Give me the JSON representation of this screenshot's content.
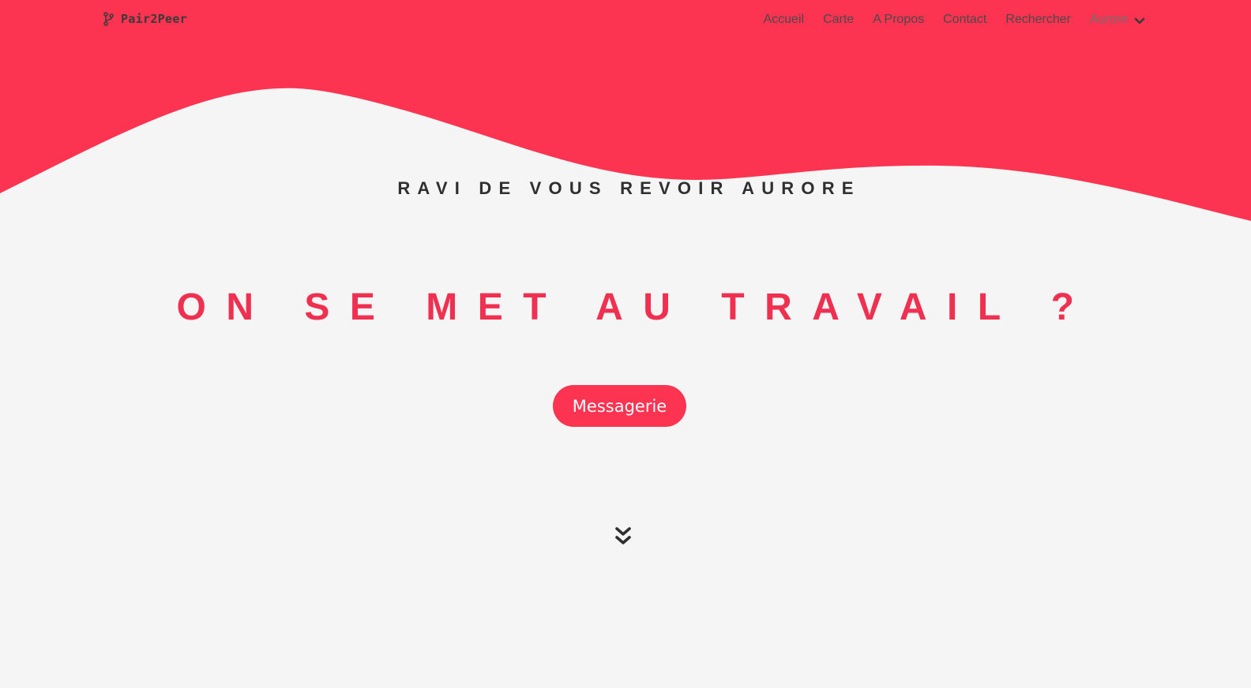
{
  "brand": {
    "name": "Pair2Peer",
    "icon": "git-branch-icon"
  },
  "nav": {
    "items": [
      {
        "label": "Accueil"
      },
      {
        "label": "Carte"
      },
      {
        "label": "A Propos"
      },
      {
        "label": "Contact"
      },
      {
        "label": "Rechercher"
      }
    ],
    "user": {
      "label": "Aurore",
      "icon": "chevron-down-icon"
    }
  },
  "hero": {
    "greeting": "RAVI DE VOUS REVOIR AURORE",
    "headline": "ON SE MET AU TRAVAIL ?",
    "cta_label": "Messagerie",
    "scroll_icon": "double-chevron-down-icon"
  },
  "colors": {
    "accent": "#fd3451",
    "background": "#f5f5f5",
    "text_dark": "#2f2f2f"
  }
}
